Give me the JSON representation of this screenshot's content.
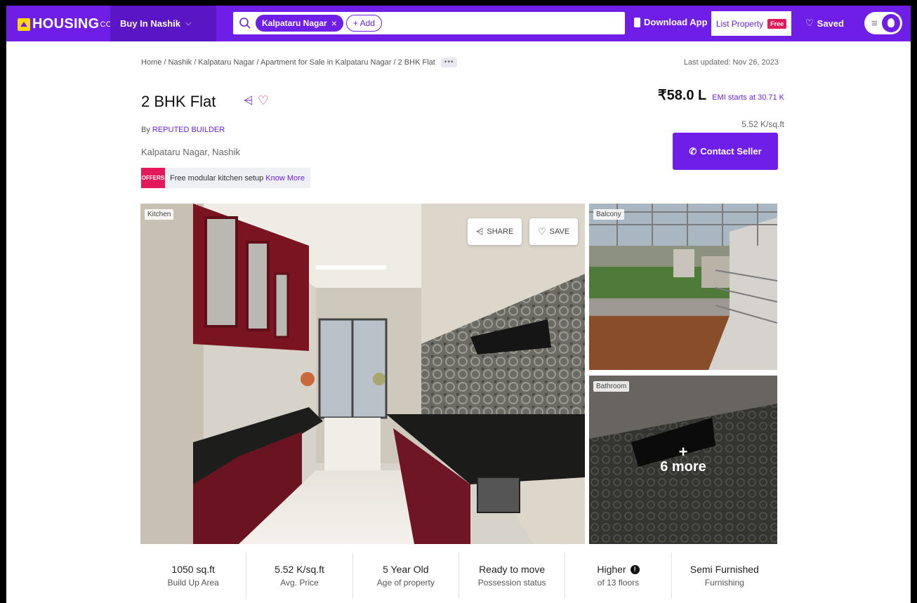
{
  "header": {
    "logo_text": "HOUSING",
    "logo_suffix": "COM",
    "buy_in_label": "Buy In Nashik",
    "search_chip": "Kalpataru Nagar",
    "add_label": "+ Add",
    "download_app": "Download App",
    "list_property": "List Property",
    "free_badge": "Free",
    "saved": "Saved"
  },
  "breadcrumb": {
    "text": "Home / Nashik / Kalpataru Nagar / Apartment for Sale in Kalpataru Nagar / 2 BHK Flat",
    "more": "•••"
  },
  "last_updated": "Last updated: Nov 26, 2023",
  "listing": {
    "title": "2 BHK Flat",
    "by_prefix": "By ",
    "builder": "REPUTED BUILDER",
    "locality": "Kalpataru Nagar, Nashik",
    "offer_tag": "OFFERS",
    "offer_text": "Free modular kitchen setup",
    "offer_link": "Know More",
    "price": "₹58.0 L",
    "emi": "EMI starts at  30.71 K",
    "price_per_sqft": "5.52 K/sq.ft",
    "contact_button": "Contact Seller"
  },
  "gallery": {
    "main_label": "Kitchen",
    "share_label": "SHARE",
    "save_label": "SAVE",
    "side1_label": "Balcony",
    "side2_label": "Bathroom",
    "more_plus": "+",
    "more_count": "6 more"
  },
  "stats": [
    {
      "value": "1050 sq.ft",
      "label": "Build Up Area"
    },
    {
      "value": "5.52 K/sq.ft",
      "label": "Avg. Price"
    },
    {
      "value": "5 Year Old",
      "label": "Age of property"
    },
    {
      "value": "Ready to move",
      "label": "Possession status"
    },
    {
      "value": "Higher",
      "label": "of 13 floors"
    },
    {
      "value": "Semi Furnished",
      "label": "Furnishing"
    }
  ],
  "colors": {
    "brand": "#6e1ee6",
    "offer": "#e4185b"
  }
}
